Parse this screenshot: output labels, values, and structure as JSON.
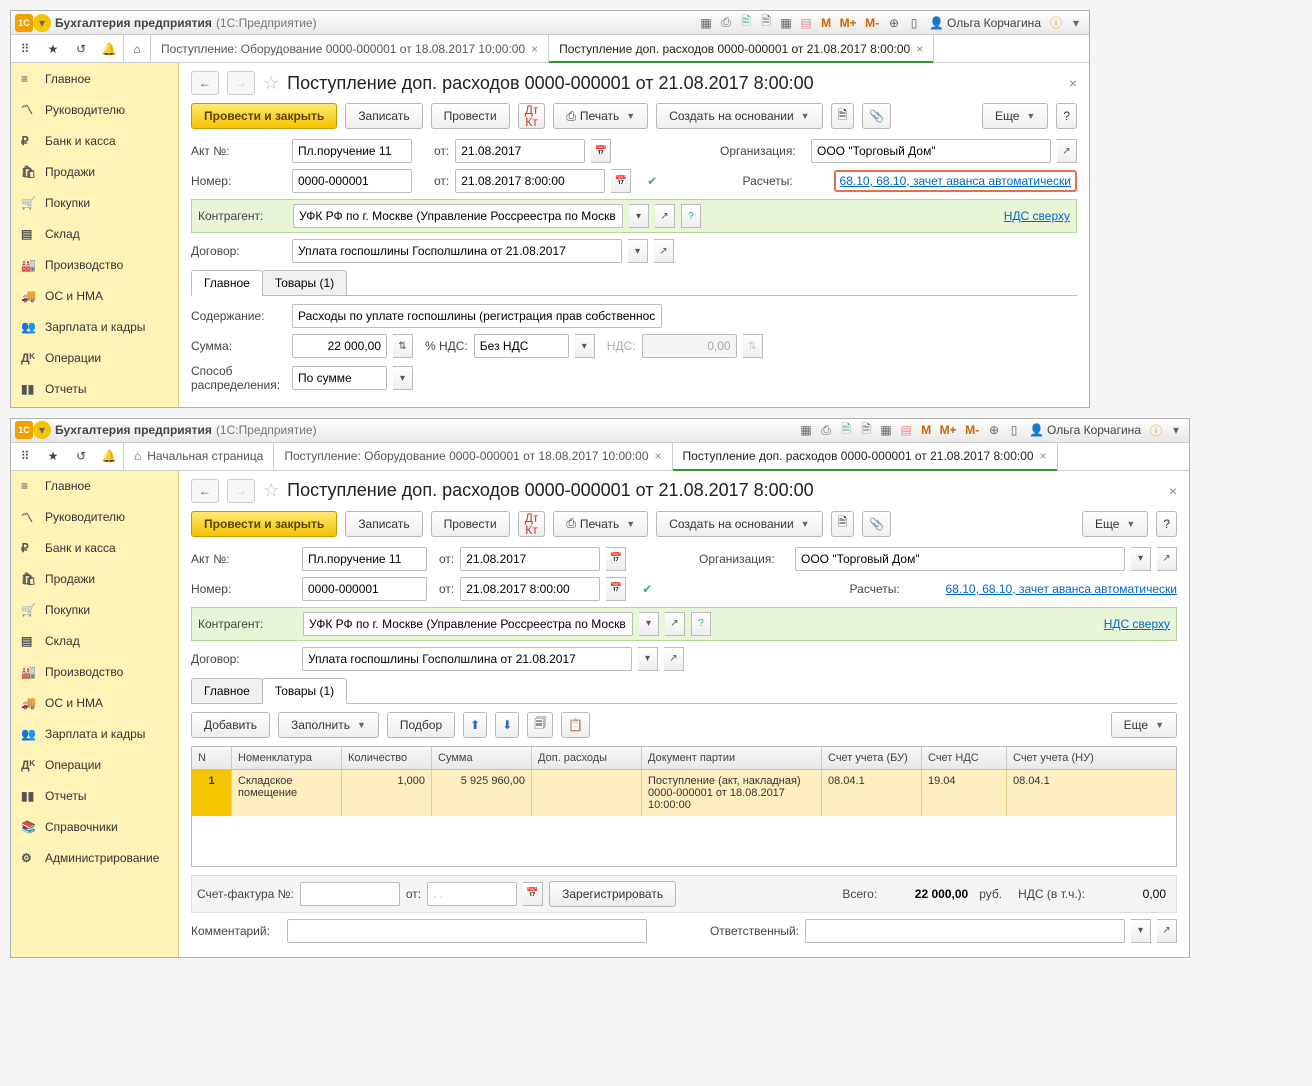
{
  "app": {
    "name": "Бухгалтерия предприятия",
    "sub": "(1С:Предприятие)",
    "user": "Ольга Корчагина"
  },
  "memory": {
    "m": "M",
    "mplus": "M+",
    "mminus": "M-"
  },
  "tabs_win1": {
    "t1": "Поступление: Оборудование 0000-000001 от 18.08.2017 10:00:00",
    "t2": "Поступление доп. расходов 0000-000001 от 21.08.2017 8:00:00"
  },
  "tabs_win2": {
    "home": "Начальная страница",
    "t1": "Поступление: Оборудование 0000-000001 от 18.08.2017 10:00:00",
    "t2": "Поступление доп. расходов 0000-000001 от 21.08.2017 8:00:00"
  },
  "nav": {
    "main": "Главное",
    "manager": "Руководителю",
    "bank": "Банк и касса",
    "sales": "Продажи",
    "purchases": "Покупки",
    "stock": "Склад",
    "prod": "Производство",
    "os": "ОС и НМА",
    "salary": "Зарплата и кадры",
    "ops": "Операции",
    "reports": "Отчеты",
    "refs": "Справочники",
    "admin": "Администрирование"
  },
  "page_title": "Поступление доп. расходов 0000-000001 от 21.08.2017 8:00:00",
  "buttons": {
    "post_close": "Провести и закрыть",
    "save": "Записать",
    "post": "Провести",
    "print": "Печать",
    "create_on": "Создать на основании",
    "more": "Еще",
    "help": "?",
    "add": "Добавить",
    "fill": "Заполнить",
    "select": "Подбор",
    "register": "Зарегистрировать"
  },
  "labels": {
    "act": "Акт №:",
    "from": "от:",
    "number": "Номер:",
    "org": "Организация:",
    "calc": "Расчеты:",
    "contragent": "Контрагент:",
    "contract": "Договор:",
    "content": "Содержание:",
    "sum": "Сумма:",
    "vat_pct": "% НДС:",
    "vat": "НДС:",
    "method": "Способ распределения:",
    "invoice": "Счет-фактура №:",
    "comment": "Комментарий:",
    "responsible": "Ответственный:",
    "total": "Всего:",
    "rub": "руб.",
    "vat_incl": "НДС (в т.ч.):"
  },
  "vals": {
    "act": "Пл.поручение 11",
    "date1": "21.08.2017",
    "number": "0000-000001",
    "datetime": "21.08.2017  8:00:00",
    "org": "ООО \"Торговый Дом\"",
    "calc_link": "68.10, 68.10, зачет аванса автоматически",
    "vat_link": "НДС сверху",
    "contragent": "УФК РФ по г. Москве (Управление Россреестра по Москв",
    "contract": "Уплата госпошлины Госполшлина от 21.08.2017",
    "content": "Расходы по уплате госпошлины (регистрация прав собственнос",
    "sum": "22 000,00",
    "vat_pct": "Без НДС",
    "vat": "0,00",
    "method": "По сумме",
    "total": "22 000,00",
    "vat_total": "0,00",
    "invoice_date": "  .  .    "
  },
  "ptabs": {
    "main": "Главное",
    "goods": "Товары (1)"
  },
  "grid": {
    "cols": {
      "n": "N",
      "nom": "Номенклатура",
      "qty": "Количество",
      "sum": "Сумма",
      "extra": "Доп. расходы",
      "doc": "Документ партии",
      "bu": "Счет учета (БУ)",
      "nds": "Счет НДС",
      "nu": "Счет учета (НУ)"
    },
    "row": {
      "n": "1",
      "nom": "Складское помещение",
      "qty": "1,000",
      "sum": "5 925 960,00",
      "extra": "",
      "doc": "Поступление (акт, накладная) 0000-000001 от 18.08.2017 10:00:00",
      "bu": "08.04.1",
      "nds": "19.04",
      "nu": "08.04.1"
    }
  }
}
